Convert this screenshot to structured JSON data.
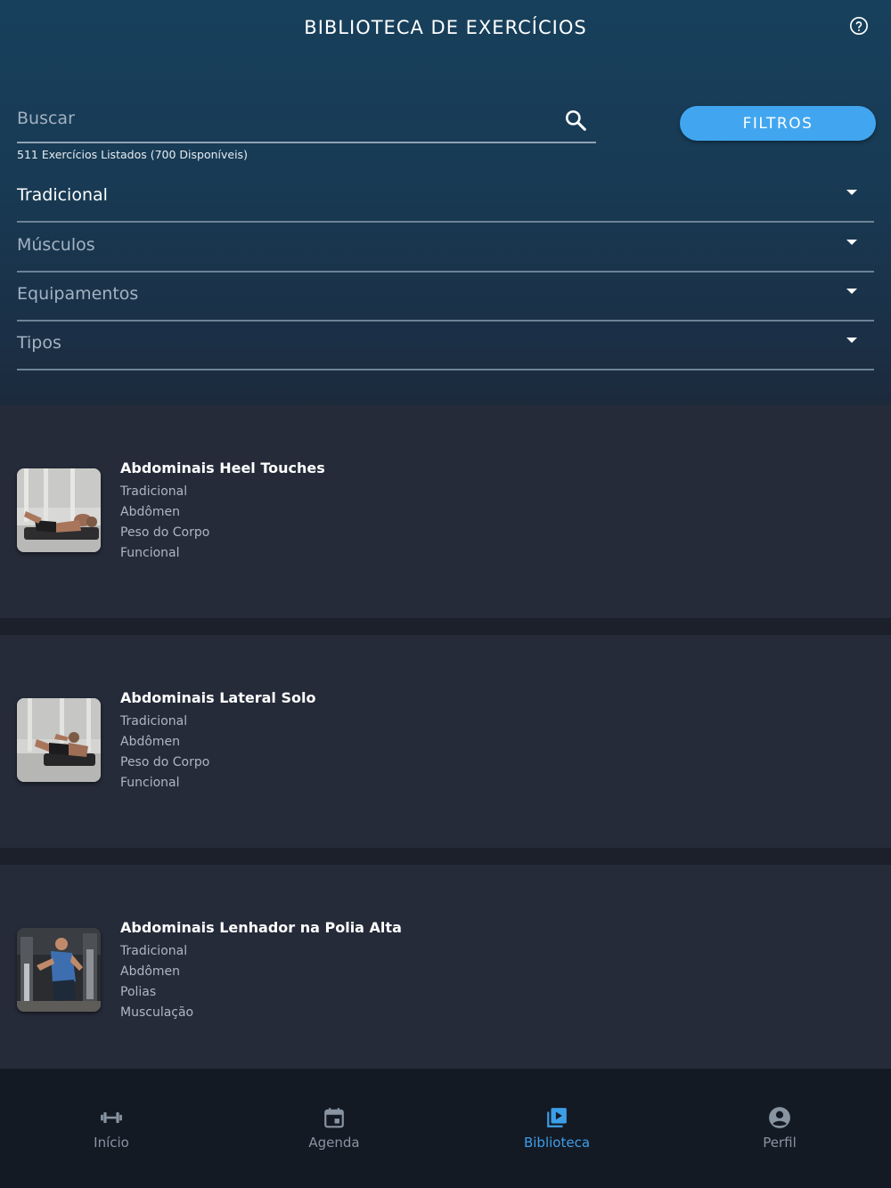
{
  "header": {
    "title": "BIBLIOTECA DE EXERCÍCIOS"
  },
  "search": {
    "placeholder": "Buscar",
    "value": "",
    "count_text": "511 Exercícios Listados (700 Disponíveis)"
  },
  "filters_button": {
    "label": "FILTROS"
  },
  "dropdowns": [
    {
      "label": "Tradicional",
      "selected": true
    },
    {
      "label": "Músculos",
      "selected": false
    },
    {
      "label": "Equipamentos",
      "selected": false
    },
    {
      "label": "Tipos",
      "selected": false
    }
  ],
  "exercises": [
    {
      "title": "Abdominais Heel Touches",
      "tags": [
        "Tradicional",
        "Abdômen",
        "Peso do Corpo",
        "Funcional"
      ]
    },
    {
      "title": "Abdominais Lateral Solo",
      "tags": [
        "Tradicional",
        "Abdômen",
        "Peso do Corpo",
        "Funcional"
      ]
    },
    {
      "title": "Abdominais Lenhador na Polia Alta",
      "tags": [
        "Tradicional",
        "Abdômen",
        "Polias",
        "Musculação"
      ]
    }
  ],
  "tabs": [
    {
      "label": "Início",
      "icon": "dumbbell-icon",
      "active": false
    },
    {
      "label": "Agenda",
      "icon": "calendar-icon",
      "active": false
    },
    {
      "label": "Biblioteca",
      "icon": "video-library-icon",
      "active": true
    },
    {
      "label": "Perfil",
      "icon": "account-circle-icon",
      "active": false
    }
  ],
  "colors": {
    "accent": "#41a6ef",
    "active_tab": "#3d9ee8",
    "card_bg": "#252b39",
    "tabbar_bg": "#141a24"
  }
}
